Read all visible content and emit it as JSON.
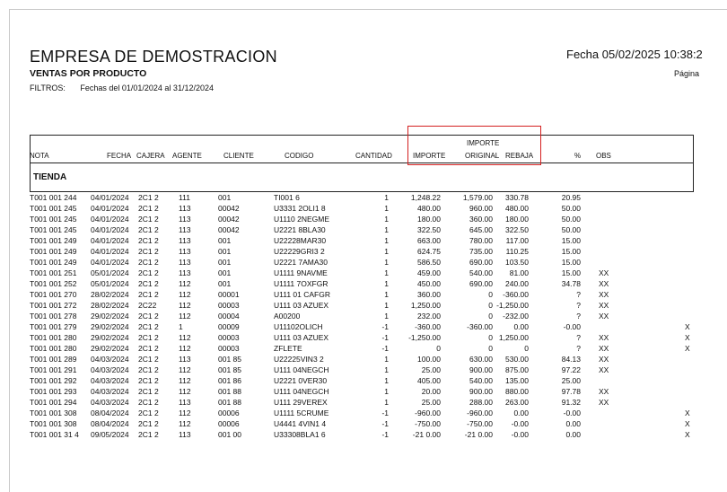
{
  "report": {
    "company": "EMPRESA DE DEMOSTRACION",
    "title": "VENTAS POR PRODUCTO",
    "filters_label": "FILTROS:",
    "filters_value": "Fechas del 01/01/2024 al 31/12/2024",
    "date_label": "Fecha 05/02/2025 10:38:2",
    "page_label": "Página"
  },
  "columns": {
    "nota": "NOTA",
    "fecha": "FECHA",
    "cajera": "CAJERA",
    "agente": "AGENTE",
    "cliente": "CLIENTE",
    "codigo": "CODIGO",
    "cantidad": "CANTIDAD",
    "importe": "IMPORTE",
    "importe_original_top": "IMPORTE",
    "importe_original_bottom": "ORIGINAL",
    "rebaja": "REBAJA",
    "pct": "%",
    "obs": "OBS"
  },
  "section": "TIENDA",
  "rows": [
    {
      "nota": "T001 001 244",
      "fecha": "04/01/2024",
      "cajera": "2C1 2",
      "agente": "111",
      "cliente": "001",
      "codigo": "TI001 6",
      "cantidad": "1",
      "importe": "1,248.22",
      "original": "1,579.00",
      "rebaja": "330.78",
      "pct": "20.95",
      "obs": "",
      "x": ""
    },
    {
      "nota": "T001 001 245",
      "fecha": "04/01/2024",
      "cajera": "2C1 2",
      "agente": "113",
      "cliente": "00042",
      "codigo": "U3331 2OLI1 8",
      "cantidad": "1",
      "importe": "480.00",
      "original": "960.00",
      "rebaja": "480.00",
      "pct": "50.00",
      "obs": "",
      "x": ""
    },
    {
      "nota": "T001 001 245",
      "fecha": "04/01/2024",
      "cajera": "2C1 2",
      "agente": "113",
      "cliente": "00042",
      "codigo": "U1110 2NEGME",
      "cantidad": "1",
      "importe": "180.00",
      "original": "360.00",
      "rebaja": "180.00",
      "pct": "50.00",
      "obs": "",
      "x": ""
    },
    {
      "nota": "T001 001 245",
      "fecha": "04/01/2024",
      "cajera": "2C1 2",
      "agente": "113",
      "cliente": "00042",
      "codigo": "U2221 8BLA30",
      "cantidad": "1",
      "importe": "322.50",
      "original": "645.00",
      "rebaja": "322.50",
      "pct": "50.00",
      "obs": "",
      "x": ""
    },
    {
      "nota": "T001 001 249",
      "fecha": "04/01/2024",
      "cajera": "2C1 2",
      "agente": "113",
      "cliente": "001",
      "codigo": "U22228MAR30",
      "cantidad": "1",
      "importe": "663.00",
      "original": "780.00",
      "rebaja": "117.00",
      "pct": "15.00",
      "obs": "",
      "x": ""
    },
    {
      "nota": "T001 001 249",
      "fecha": "04/01/2024",
      "cajera": "2C1 2",
      "agente": "113",
      "cliente": "001",
      "codigo": "U22229GRI3 2",
      "cantidad": "1",
      "importe": "624.75",
      "original": "735.00",
      "rebaja": "110.25",
      "pct": "15.00",
      "obs": "",
      "x": ""
    },
    {
      "nota": "T001 001 249",
      "fecha": "04/01/2024",
      "cajera": "2C1 2",
      "agente": "113",
      "cliente": "001",
      "codigo": "U2221 7AMA30",
      "cantidad": "1",
      "importe": "586.50",
      "original": "690.00",
      "rebaja": "103.50",
      "pct": "15.00",
      "obs": "",
      "x": ""
    },
    {
      "nota": "T001 001 251",
      "fecha": "05/01/2024",
      "cajera": "2C1 2",
      "agente": "113",
      "cliente": "001",
      "codigo": "U1111 9NAVME",
      "cantidad": "1",
      "importe": "459.00",
      "original": "540.00",
      "rebaja": "81.00",
      "pct": "15.00",
      "obs": "XX",
      "x": ""
    },
    {
      "nota": "T001 001 252",
      "fecha": "05/01/2024",
      "cajera": "2C1 2",
      "agente": "112",
      "cliente": "001",
      "codigo": "U1111 7OXFGR",
      "cantidad": "1",
      "importe": "450.00",
      "original": "690.00",
      "rebaja": "240.00",
      "pct": "34.78",
      "obs": "XX",
      "x": ""
    },
    {
      "nota": "T001 001 270",
      "fecha": "28/02/2024",
      "cajera": "2C1 2",
      "agente": "112",
      "cliente": "00001",
      "codigo": "U111 01 CAFGR",
      "cantidad": "1",
      "importe": "360.00",
      "original": "0",
      "rebaja": "-360.00",
      "pct": "?",
      "obs": "XX",
      "x": ""
    },
    {
      "nota": "T001 001 272",
      "fecha": "28/02/2024",
      "cajera": "2C22",
      "agente": "112",
      "cliente": "00003",
      "codigo": "U111 03 AZUEX",
      "cantidad": "1",
      "importe": "1,250.00",
      "original": "0",
      "rebaja": "-1,250.00",
      "pct": "?",
      "obs": "XX",
      "x": ""
    },
    {
      "nota": "T001 001 278",
      "fecha": "29/02/2024",
      "cajera": "2C1 2",
      "agente": "112",
      "cliente": "00004",
      "codigo": "A00200",
      "cantidad": "1",
      "importe": "232.00",
      "original": "0",
      "rebaja": "-232.00",
      "pct": "?",
      "obs": "XX",
      "x": ""
    },
    {
      "nota": "T001 001 279",
      "fecha": "29/02/2024",
      "cajera": "2C1 2",
      "agente": "1",
      "cliente": "00009",
      "codigo": "U11102OLICH",
      "cantidad": "-1",
      "importe": "-360.00",
      "original": "-360.00",
      "rebaja": "0.00",
      "pct": "-0.00",
      "obs": "",
      "x": "X"
    },
    {
      "nota": "T001 001 280",
      "fecha": "29/02/2024",
      "cajera": "2C1 2",
      "agente": "112",
      "cliente": "00003",
      "codigo": "U111 03 AZUEX",
      "cantidad": "-1",
      "importe": "-1,250.00",
      "original": "0",
      "rebaja": "1,250.00",
      "pct": "?",
      "obs": "XX",
      "x": "X"
    },
    {
      "nota": "T001 001 280",
      "fecha": "29/02/2024",
      "cajera": "2C1 2",
      "agente": "112",
      "cliente": "00003",
      "codigo": "ZFLETE",
      "cantidad": "-1",
      "importe": "0",
      "original": "0",
      "rebaja": "0",
      "pct": "?",
      "obs": "XX",
      "x": "X"
    },
    {
      "nota": "T001 001 289",
      "fecha": "04/03/2024",
      "cajera": "2C1 2",
      "agente": "113",
      "cliente": "001 85",
      "codigo": "U22225VIN3 2",
      "cantidad": "1",
      "importe": "100.00",
      "original": "630.00",
      "rebaja": "530.00",
      "pct": "84.13",
      "obs": "XX",
      "x": ""
    },
    {
      "nota": "T001 001 291",
      "fecha": "04/03/2024",
      "cajera": "2C1 2",
      "agente": "112",
      "cliente": "001 85",
      "codigo": "U111 04NEGCH",
      "cantidad": "1",
      "importe": "25.00",
      "original": "900.00",
      "rebaja": "875.00",
      "pct": "97.22",
      "obs": "XX",
      "x": ""
    },
    {
      "nota": "T001 001 292",
      "fecha": "04/03/2024",
      "cajera": "2C1 2",
      "agente": "112",
      "cliente": "001 86",
      "codigo": "U2221 0VER30",
      "cantidad": "1",
      "importe": "405.00",
      "original": "540.00",
      "rebaja": "135.00",
      "pct": "25.00",
      "obs": "",
      "x": ""
    },
    {
      "nota": "T001 001 293",
      "fecha": "04/03/2024",
      "cajera": "2C1 2",
      "agente": "112",
      "cliente": "001 88",
      "codigo": "U111 04NEGCH",
      "cantidad": "1",
      "importe": "20.00",
      "original": "900.00",
      "rebaja": "880.00",
      "pct": "97.78",
      "obs": "XX",
      "x": ""
    },
    {
      "nota": "T001 001 294",
      "fecha": "04/03/2024",
      "cajera": "2C1 2",
      "agente": "113",
      "cliente": "001 88",
      "codigo": "U111 29VEREX",
      "cantidad": "1",
      "importe": "25.00",
      "original": "288.00",
      "rebaja": "263.00",
      "pct": "91.32",
      "obs": "XX",
      "x": ""
    },
    {
      "nota": "T001 001 308",
      "fecha": "08/04/2024",
      "cajera": "2C1 2",
      "agente": "112",
      "cliente": "00006",
      "codigo": "U1111 5CRUME",
      "cantidad": "-1",
      "importe": "-960.00",
      "original": "-960.00",
      "rebaja": "0.00",
      "pct": "-0.00",
      "obs": "",
      "x": "X"
    },
    {
      "nota": "T001 001 308",
      "fecha": "08/04/2024",
      "cajera": "2C1 2",
      "agente": "112",
      "cliente": "00006",
      "codigo": "U4441 4VIN1 4",
      "cantidad": "-1",
      "importe": "-750.00",
      "original": "-750.00",
      "rebaja": "-0.00",
      "pct": "0.00",
      "obs": "",
      "x": "X"
    },
    {
      "nota": "T001 001 31 4",
      "fecha": "09/05/2024",
      "cajera": "2C1 2",
      "agente": "113",
      "cliente": "001 00",
      "codigo": "U33308BLA1 6",
      "cantidad": "-1",
      "importe": "-21 0.00",
      "original": "-21 0.00",
      "rebaja": "-0.00",
      "pct": "0.00",
      "obs": "",
      "x": "X"
    }
  ]
}
